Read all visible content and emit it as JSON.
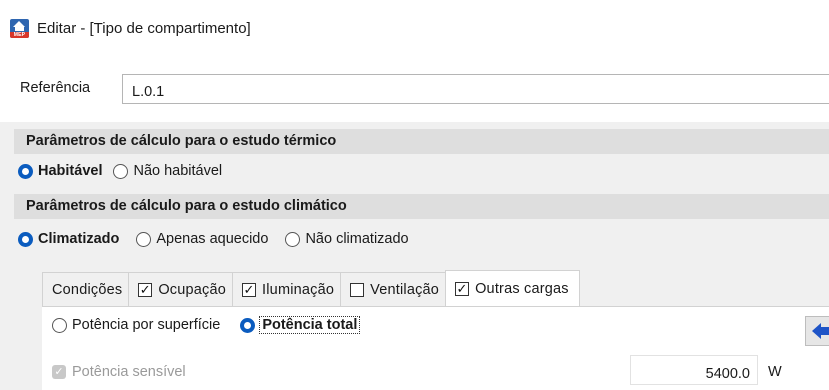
{
  "window": {
    "title": "Editar - [Tipo de compartimento]",
    "icon": "mep-app-icon",
    "icon_badge": "MEP"
  },
  "referencia": {
    "label": "Referência",
    "value": "L.0.1"
  },
  "thermal": {
    "header": "Parâmetros de cálculo para o estudo térmico",
    "options": [
      {
        "label": "Habitável",
        "selected": true
      },
      {
        "label": "Não habitável",
        "selected": false
      }
    ]
  },
  "climatic": {
    "header": "Parâmetros de cálculo para o estudo climático",
    "options": [
      {
        "label": "Climatizado",
        "selected": true
      },
      {
        "label": "Apenas aquecido",
        "selected": false
      },
      {
        "label": "Não climatizado",
        "selected": false
      }
    ]
  },
  "tabs": [
    {
      "label": "Condições",
      "checkbox": false,
      "checked": false,
      "active": false
    },
    {
      "label": "Ocupação",
      "checkbox": true,
      "checked": true,
      "active": false
    },
    {
      "label": "Iluminação",
      "checkbox": true,
      "checked": true,
      "active": false
    },
    {
      "label": "Ventilação",
      "checkbox": true,
      "checked": false,
      "active": false
    },
    {
      "label": "Outras cargas",
      "checkbox": true,
      "checked": true,
      "active": true
    }
  ],
  "outras_cargas": {
    "power_mode": [
      {
        "label": "Potência por superfície",
        "selected": false
      },
      {
        "label": "Potência total",
        "selected": true
      }
    ],
    "sensible": {
      "label": "Potência sensível",
      "checked": true,
      "enabled": false,
      "value": "5400.0",
      "unit": "W"
    }
  },
  "colors": {
    "accent": "#0b5cbf",
    "section_bg": "#dedede",
    "panel_bg": "#f0f0f0",
    "arrow": "#1e54c7"
  }
}
